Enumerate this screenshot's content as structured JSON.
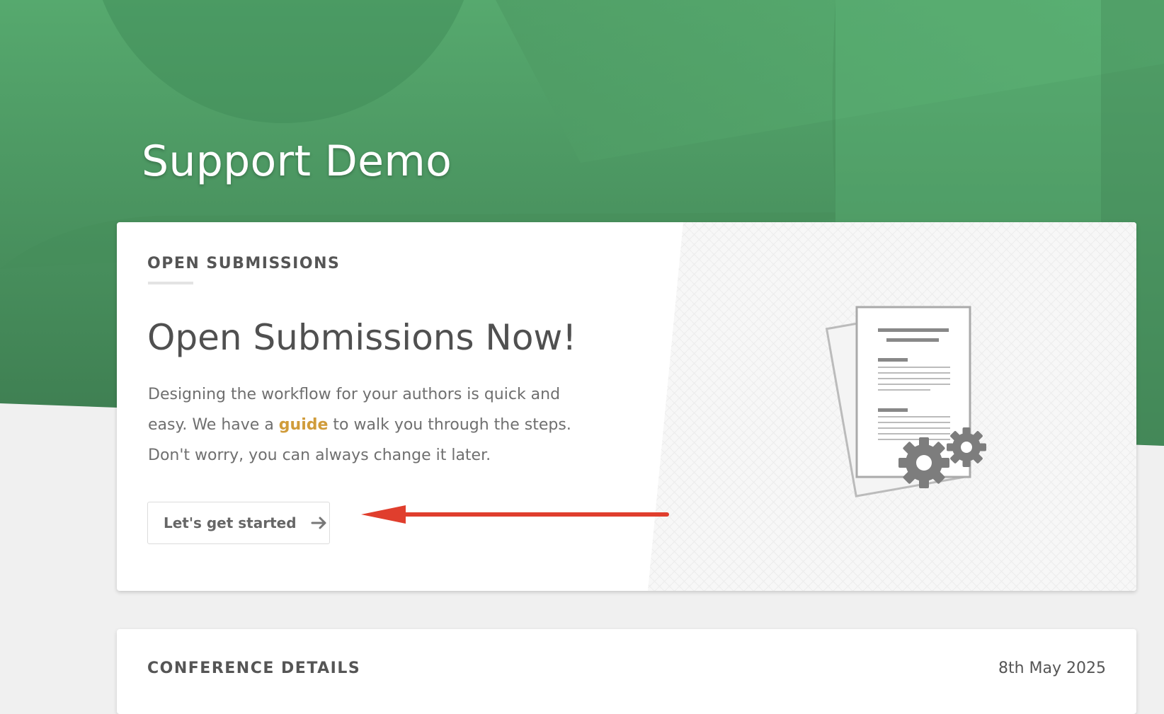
{
  "header": {
    "title": "Support Demo"
  },
  "open_submissions": {
    "section_label": "OPEN SUBMISSIONS",
    "headline": "Open Submissions Now!",
    "desc_before": "Designing the workflow for your authors is quick and easy. We have a ",
    "desc_link": "guide",
    "desc_after": " to walk you through the steps. Don't worry, you can always change it later.",
    "cta_label": "Let's get started",
    "cta_icon": "arrow-right-icon",
    "illustration_icon": "documents-with-gears-icon"
  },
  "conference_details": {
    "section_label": "CONFERENCE DETAILS",
    "date": "8th May 2025"
  },
  "colors": {
    "hero_green": "#4f9e66",
    "hero_green_dark": "#3c7a50",
    "link_gold": "#d09c3b",
    "annotation_red": "#e03e2d",
    "text_gray": "#555555"
  }
}
